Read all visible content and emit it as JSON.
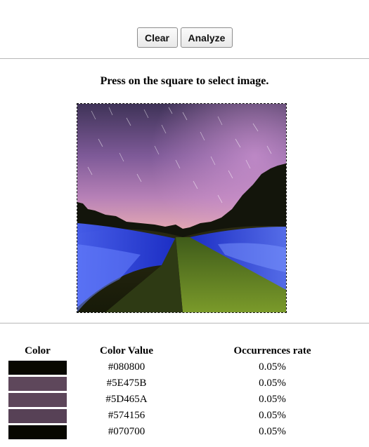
{
  "toolbar": {
    "clear_label": "Clear",
    "analyze_label": "Analyze"
  },
  "instruction": "Press on the square to select image.",
  "table": {
    "headers": [
      "Color",
      "Color Value",
      "Occurrences rate"
    ],
    "rows": [
      {
        "color": "#080800",
        "value": "#080800",
        "rate": "0.05%"
      },
      {
        "color": "#5E475B",
        "value": "#5E475B",
        "rate": "0.05%"
      },
      {
        "color": "#5D465A",
        "value": "#5D465A",
        "rate": "0.05%"
      },
      {
        "color": "#574156",
        "value": "#574156",
        "rate": "0.05%"
      },
      {
        "color": "#070700",
        "value": "#070700",
        "rate": "0.05%"
      }
    ]
  }
}
